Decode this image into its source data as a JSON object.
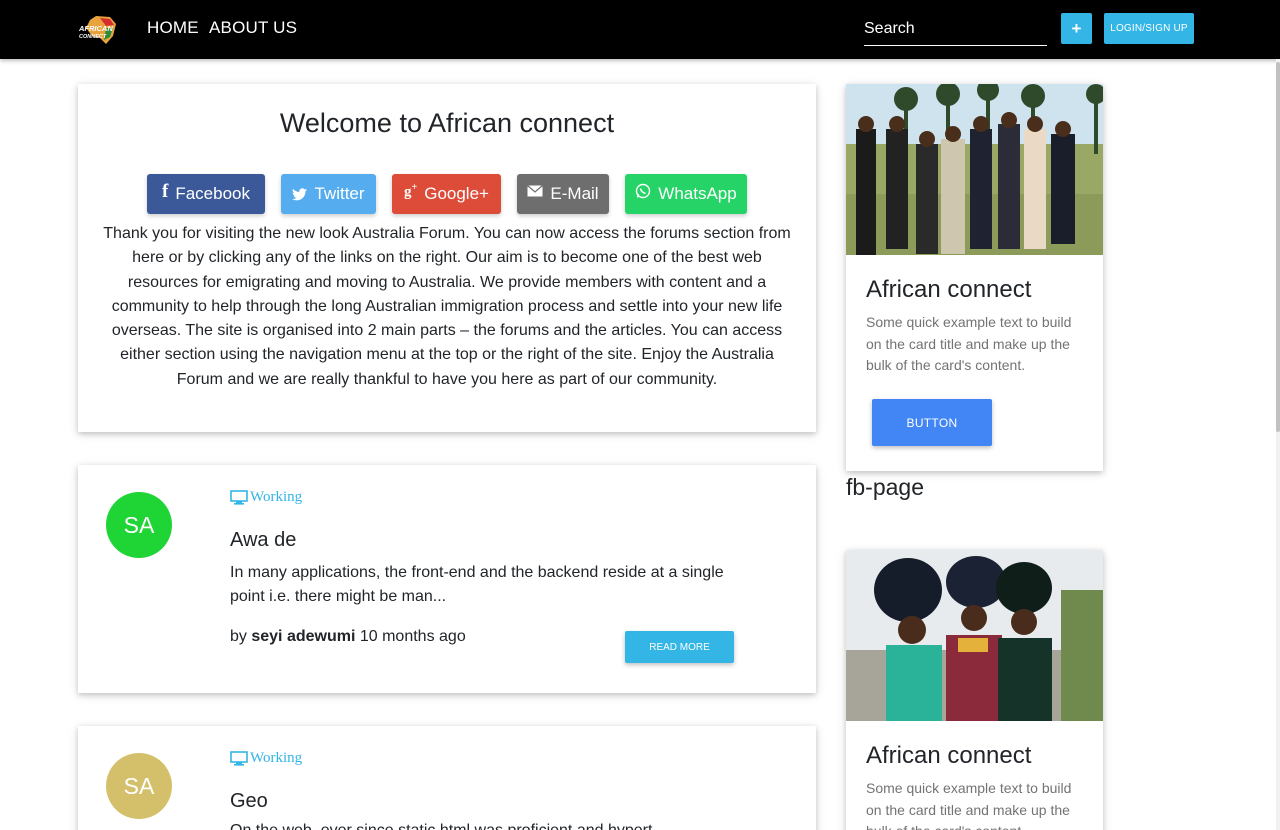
{
  "navbar": {
    "logo_text_1": "AFRICAN",
    "logo_text_2": "CONNECT",
    "home": "HOME",
    "about": "ABOUT US",
    "search_placeholder": "Search",
    "plus_label": "+",
    "login_label": "LOGIN/SIGN UP"
  },
  "welcome": {
    "title": "Welcome to African connect",
    "share_buttons": [
      {
        "label": "Facebook",
        "icon": "facebook-icon",
        "color": "#3b5998"
      },
      {
        "label": "Twitter",
        "icon": "twitter-icon",
        "color": "#55acee"
      },
      {
        "label": "Google+",
        "icon": "google-plus-icon",
        "color": "#dd4b39"
      },
      {
        "label": "E-Mail",
        "icon": "email-icon",
        "color": "#6e6e6e"
      },
      {
        "label": "WhatsApp",
        "icon": "whatsapp-icon",
        "color": "#25d366"
      }
    ],
    "body": "Thank you for visiting the new look Australia Forum. You can now access the forums section from here or by clicking any of the links on the right. Our aim is to become one of the best web resources for emigrating and moving to Australia. We provide members with content and a community to help through the long Australian immigration process and settle into your new life overseas. The site is organised into 2 main parts – the forums and the articles. You can access either section using the navigation menu at the top or the right of the site. Enjoy the Australia Forum and we are really thankful to have you here as part of our community."
  },
  "posts": [
    {
      "avatar_initials": "SA",
      "avatar_color": "#1fd435",
      "category": "Working",
      "title": "Awa de",
      "excerpt": "In many applications, the front-end and the backend reside at a single point i.e. there might be man...",
      "by": "by",
      "author": "seyi adewumi",
      "time": "10 months ago",
      "read_more": "READ MORE"
    },
    {
      "avatar_initials": "SA",
      "avatar_color": "#d4c06b",
      "category": "Working",
      "title": "Geo",
      "excerpt": "On the web, ever since static html was proficient and hypert..."
    }
  ],
  "sidebar": {
    "cards": [
      {
        "title": "African connect",
        "text": "Some quick example text to build on the card title and make up the bulk of the card's content.",
        "button": "BUTTON"
      },
      {
        "title": "African connect",
        "text": "Some quick example text to build on the card title and make up the bulk of the card's content."
      }
    ],
    "fb_page": "fb-page"
  },
  "colors": {
    "accent": "#33b5e5",
    "primary_button": "#4285f4",
    "navbar": "#000000"
  }
}
